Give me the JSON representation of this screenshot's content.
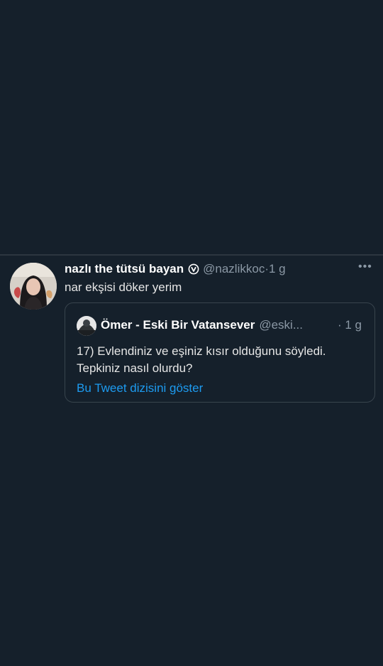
{
  "tweet": {
    "display_name": "nazlı the tütsü bayan",
    "handle": "@nazlikkoc",
    "separator": "·",
    "time": "1 g",
    "text": "nar ekşisi döker yerim",
    "verified_icon": "verified-circle-icon",
    "more_icon": "more-options-icon"
  },
  "quoted_tweet": {
    "display_name": "Ömer - Eski Bir Vatansever",
    "handle": "@eski...",
    "time": "· 1 g",
    "text": "17) Evlendiniz ve eşiniz kısır olduğunu söyledi. Tepkiniz nasıl olurdu?",
    "show_thread_label": "Bu Tweet dizisini göster"
  },
  "colors": {
    "background": "#15202b",
    "link": "#1d9bf0",
    "secondary_text": "#8b98a5",
    "border": "#38444d"
  }
}
